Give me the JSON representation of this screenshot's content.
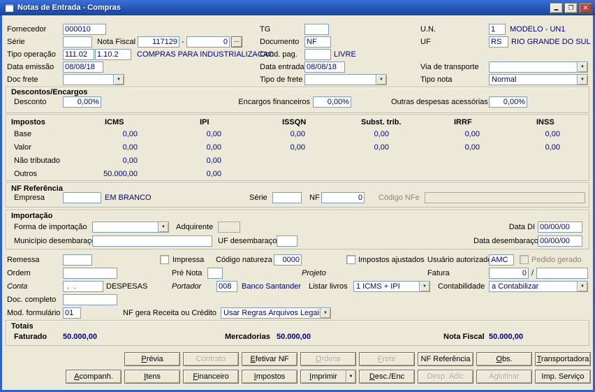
{
  "window": {
    "title": "Notas de Entrada - Compras"
  },
  "icons": {
    "dropdown_arrow": "▼",
    "minimize": "▬",
    "maximize": "❐",
    "close": "✕"
  },
  "fields": {
    "fornecedor": {
      "label": "Fornecedor",
      "value": "000010"
    },
    "tg": {
      "label": "TG",
      "value": ""
    },
    "un": {
      "label": "U.N.",
      "value": "1",
      "desc": "MODELO - UN1"
    },
    "serie": {
      "label": "Série",
      "value": ""
    },
    "nota_fiscal": {
      "label": "Nota Fiscal",
      "numero": "117129",
      "sep": "-",
      "serie2": "0",
      "browse": "..."
    },
    "documento": {
      "label": "Documento",
      "value": "NF"
    },
    "uf": {
      "label": "UF",
      "value": "RS",
      "desc": "RIO GRANDE DO SUL"
    },
    "tipo_operacao": {
      "label": "Tipo operação",
      "codigo": "111.02",
      "natureza": "1.10.2",
      "desc": "COMPRAS PARA INDUSTRIALIZACAC"
    },
    "cond_pag": {
      "label": "Cond. pag.",
      "value": "",
      "desc": "LIVRE"
    },
    "data_emissao": {
      "label": "Data emissão",
      "value": "08/08/18"
    },
    "data_entrada": {
      "label": "Data entrada",
      "value": "08/08/18"
    },
    "via_transporte": {
      "label": "Via de transporte",
      "value": ""
    },
    "doc_frete": {
      "label": "Doc frete",
      "value": ""
    },
    "tipo_frete": {
      "label": "Tipo de frete",
      "value": ""
    },
    "tipo_nota": {
      "label": "Tipo nota",
      "value": "Normal"
    }
  },
  "descontos": {
    "title": "Descontos/Encargos",
    "desconto": {
      "label": "Desconto",
      "value": "0,00%"
    },
    "encargos": {
      "label": "Encargos financeiros",
      "value": "0,00%"
    },
    "outras": {
      "label": "Outras despesas acessórias",
      "value": "0,00%"
    }
  },
  "impostos": {
    "title": "Impostos",
    "columns": [
      "ICMS",
      "IPI",
      "ISSQN",
      "Subst. trib.",
      "IRRF",
      "INSS"
    ],
    "rows": [
      {
        "label": "Base",
        "values": [
          "0,00",
          "0,00",
          "0,00",
          "0,00",
          "0,00",
          "0,00"
        ]
      },
      {
        "label": "Valor",
        "values": [
          "0,00",
          "0,00",
          "0,00",
          "0,00",
          "0,00",
          "0,00"
        ]
      },
      {
        "label": "Não tributado",
        "values": [
          "0,00",
          "0,00",
          "",
          "",
          "",
          ""
        ]
      },
      {
        "label": "Outros",
        "values": [
          "50.000,00",
          "0,00",
          "",
          "",
          "",
          ""
        ]
      }
    ]
  },
  "nf_referencia": {
    "title": "NF Referência",
    "empresa": {
      "label": "Empresa",
      "value": "",
      "desc": "EM BRANCO"
    },
    "serie": {
      "label": "Série",
      "value": ""
    },
    "nf": {
      "label": "NF",
      "value": "0"
    },
    "codigo_nfe": {
      "label": "Código NFe",
      "value": ""
    }
  },
  "importacao": {
    "title": "Importação",
    "forma": {
      "label": "Forma de importação",
      "value": ""
    },
    "adquirente": {
      "label": "Adquirente",
      "value": ""
    },
    "data_di": {
      "label": "Data DI",
      "value": "00/00/00"
    },
    "municipio": {
      "label": "Município desembaraço",
      "value": ""
    },
    "uf_desembaraco": {
      "label": "UF desembaraço",
      "value": ""
    },
    "data_desembaraco": {
      "label": "Data desembaraço",
      "value": "00/00/00"
    }
  },
  "detalhes": {
    "remessa": {
      "label": "Remessa",
      "value": ""
    },
    "impressa": {
      "label": "Impressa",
      "checked": false
    },
    "codigo_natureza": {
      "label": "Código natureza",
      "value": "0000"
    },
    "impostos_ajustados": {
      "label": "Impostos ajustados",
      "checked": false
    },
    "usuario_autorizado": {
      "label": "Usuário autorizado",
      "value": "AMC"
    },
    "pedido_gerado": {
      "label": "Pedido gerado",
      "checked": false,
      "disabled": true
    },
    "ordem": {
      "label": "Ordem",
      "value": ""
    },
    "pre_nota": {
      "label": "Pré Nota",
      "value": ""
    },
    "projeto": {
      "label": "Projeto"
    },
    "fatura": {
      "label": "Fatura",
      "value": "0",
      "sep": "/",
      "value2": ""
    },
    "conta": {
      "label": "Conta",
      "value": " .  .",
      "desc": "DESPESAS"
    },
    "portador": {
      "label": "Portador",
      "value": "008",
      "desc": "Banco Santander"
    },
    "listar_livros": {
      "label": "Listar livros",
      "value": "1 ICMS + IPI"
    },
    "contabilidade": {
      "label": "Contabilidade",
      "value": "a Contabilizar"
    },
    "doc_completo": {
      "label": "Doc. completo",
      "value": ""
    },
    "mod_formulario": {
      "label": "Mod. formulário",
      "value": "01"
    },
    "nf_gera": {
      "label": "NF gera Receita ou Crédito",
      "value": "Usar Regras Arquivos Legais"
    }
  },
  "totais": {
    "title": "Totais",
    "faturado": {
      "label": "Faturado",
      "value": "50.000,00"
    },
    "mercadorias": {
      "label": "Mercadorias",
      "value": "50.000,00"
    },
    "nota_fiscal": {
      "label": "Nota Fiscal",
      "value": "50.000,00"
    }
  },
  "buttons": {
    "row1": [
      {
        "label": "Prévia",
        "enabled": true,
        "u": 0
      },
      {
        "label": "Contrato",
        "enabled": false
      },
      {
        "label": "Efetivar NF",
        "enabled": true,
        "u": 0
      },
      {
        "label": "Ordens",
        "enabled": false,
        "u": 0
      },
      {
        "label": "Frete",
        "enabled": false,
        "u": 0
      },
      {
        "label": "NF Referência",
        "enabled": true
      },
      {
        "label": "Obs.",
        "enabled": true,
        "u": 0
      },
      {
        "label": "Transportadora",
        "enabled": true,
        "u": 0
      }
    ],
    "row2": [
      {
        "label": "Acompanh.",
        "enabled": true,
        "u": 0
      },
      {
        "label": "Itens",
        "enabled": true,
        "u": 0
      },
      {
        "label": "Financeiro",
        "enabled": true,
        "u": 0
      },
      {
        "label": "Impostos",
        "enabled": true,
        "u": 0
      },
      {
        "label": "Imprimir",
        "enabled": true,
        "u": 0,
        "split": true
      },
      {
        "label": "Desc./Enc",
        "enabled": true,
        "u": 0
      },
      {
        "label": "Desp. Adic",
        "enabled": false
      },
      {
        "label": "Aglutinar",
        "enabled": false
      },
      {
        "label": "Imp. Serviço",
        "enabled": true
      }
    ]
  },
  "colors": {
    "value_text": "#000080",
    "titlebar": "#2456b8"
  }
}
